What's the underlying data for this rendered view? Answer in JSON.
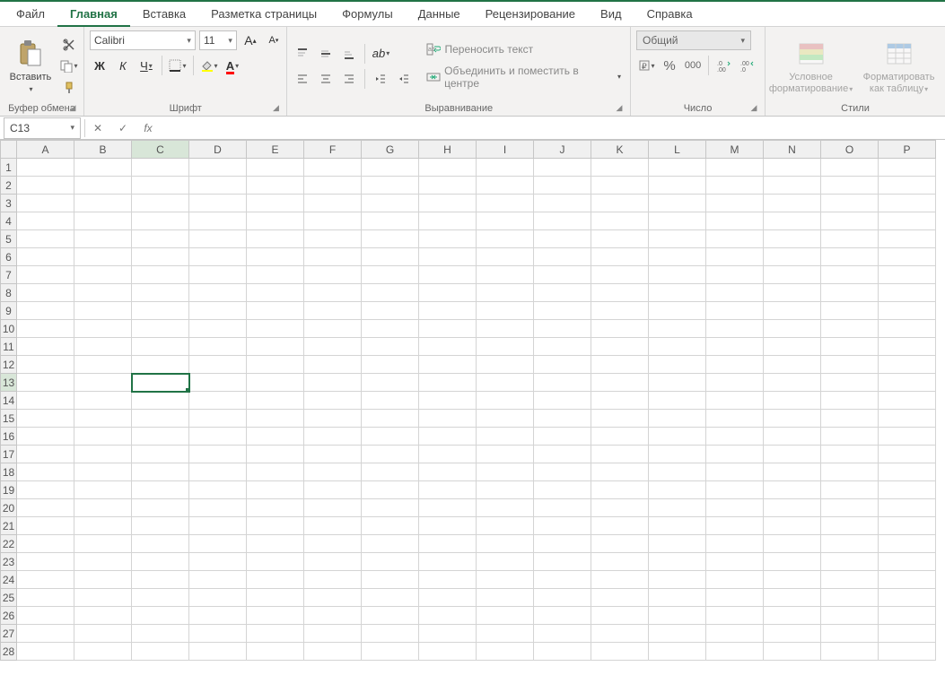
{
  "menu": {
    "tabs": [
      "Файл",
      "Главная",
      "Вставка",
      "Разметка страницы",
      "Формулы",
      "Данные",
      "Рецензирование",
      "Вид",
      "Справка"
    ],
    "active_index": 1
  },
  "ribbon": {
    "clipboard": {
      "label": "Буфер обмена",
      "paste": "Вставить"
    },
    "font": {
      "label": "Шрифт",
      "name": "Calibri",
      "size": "11",
      "bold": "Ж",
      "italic": "К",
      "underline": "Ч"
    },
    "alignment": {
      "label": "Выравнивание",
      "wrap": "Переносить текст",
      "merge": "Объединить и поместить в центре"
    },
    "number": {
      "label": "Число",
      "format": "Общий"
    },
    "styles": {
      "label": "Стили",
      "conditional": "Условное форматирование",
      "as_table": "Форматировать как таблицу"
    }
  },
  "namebox": {
    "ref": "C13"
  },
  "fx_label": "fx",
  "formula_value": "",
  "grid": {
    "cols": [
      "A",
      "B",
      "C",
      "D",
      "E",
      "F",
      "G",
      "H",
      "I",
      "J",
      "K",
      "L",
      "M",
      "N",
      "O",
      "P"
    ],
    "rows": 28,
    "selected": {
      "col": "C",
      "row": 13
    }
  }
}
